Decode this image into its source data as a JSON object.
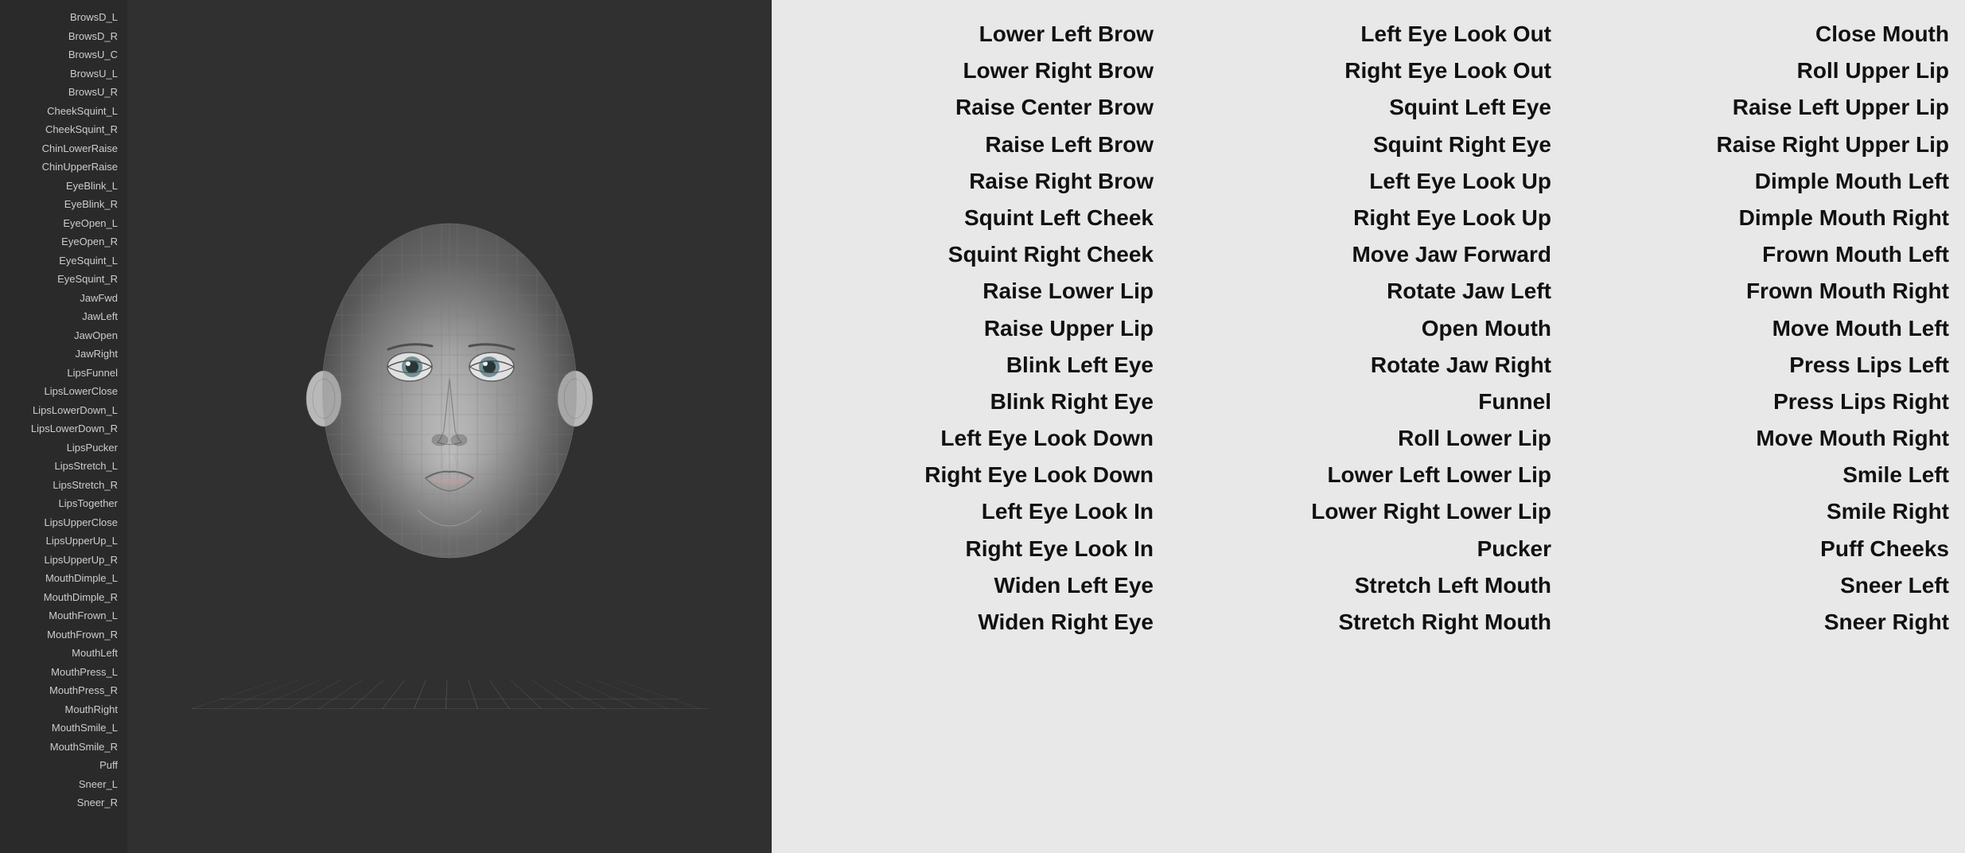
{
  "leftPanel": {
    "blendshapes": [
      "BrowsD_L",
      "BrowsD_R",
      "BrowsU_C",
      "BrowsU_L",
      "BrowsU_R",
      "CheekSquint_L",
      "CheekSquint_R",
      "ChinLowerRaise",
      "ChinUpperRaise",
      "EyeBlink_L",
      "EyeBlink_R",
      "EyeOpen_L",
      "EyeOpen_R",
      "EyeSquint_L",
      "EyeSquint_R",
      "JawFwd",
      "JawLeft",
      "JawOpen",
      "JawRight",
      "LipsFunnel",
      "LipsLowerClose",
      "LipsLowerDown_L",
      "LipsLowerDown_R",
      "LipsPucker",
      "LipsStretch_L",
      "LipsStretch_R",
      "LipsTogether",
      "LipsUpperClose",
      "LipsUpperUp_L",
      "LipsUpperUp_R",
      "MouthDimple_L",
      "MouthDimple_R",
      "MouthFrown_L",
      "MouthFrown_R",
      "MouthLeft",
      "MouthPress_L",
      "MouthPress_R",
      "MouthRight",
      "MouthSmile_L",
      "MouthSmile_R",
      "Puff",
      "Sneer_L",
      "Sneer_R"
    ]
  },
  "columns": [
    {
      "items": [
        "Lower Left Brow",
        "Lower Right Brow",
        "Raise Center Brow",
        "Raise Left Brow",
        "Raise Right Brow",
        "Squint Left Cheek",
        "Squint Right Cheek",
        "Raise Lower Lip",
        "Raise Upper Lip",
        "Blink Left Eye",
        "Blink Right Eye",
        "Left Eye Look Down",
        "Right Eye Look Down",
        "Left Eye Look In",
        "Right Eye Look In",
        "Widen Left Eye",
        "Widen Right Eye"
      ]
    },
    {
      "items": [
        "Left Eye Look Out",
        "Right Eye Look Out",
        "Squint Left Eye",
        "Squint Right Eye",
        "Left Eye Look Up",
        "Right Eye Look Up",
        "Move Jaw Forward",
        "Rotate Jaw Left",
        "Open Mouth",
        "Rotate Jaw Right",
        "Funnel",
        "Roll Lower Lip",
        "Lower Left Lower Lip",
        "Lower Right Lower Lip",
        "Pucker",
        "Stretch Left Mouth",
        "Stretch Right Mouth"
      ]
    },
    {
      "items": [
        "Close Mouth",
        "Roll Upper Lip",
        "Raise Left Upper Lip",
        "Raise Right Upper Lip",
        "Dimple Mouth Left",
        "Dimple Mouth Right",
        "Frown Mouth Left",
        "Frown Mouth Right",
        "Move Mouth Left",
        "Press Lips Left",
        "Press Lips Right",
        "Move Mouth Right",
        "Smile Left",
        "Smile Right",
        "Puff Cheeks",
        "Sneer Left",
        "Sneer Right"
      ]
    }
  ]
}
